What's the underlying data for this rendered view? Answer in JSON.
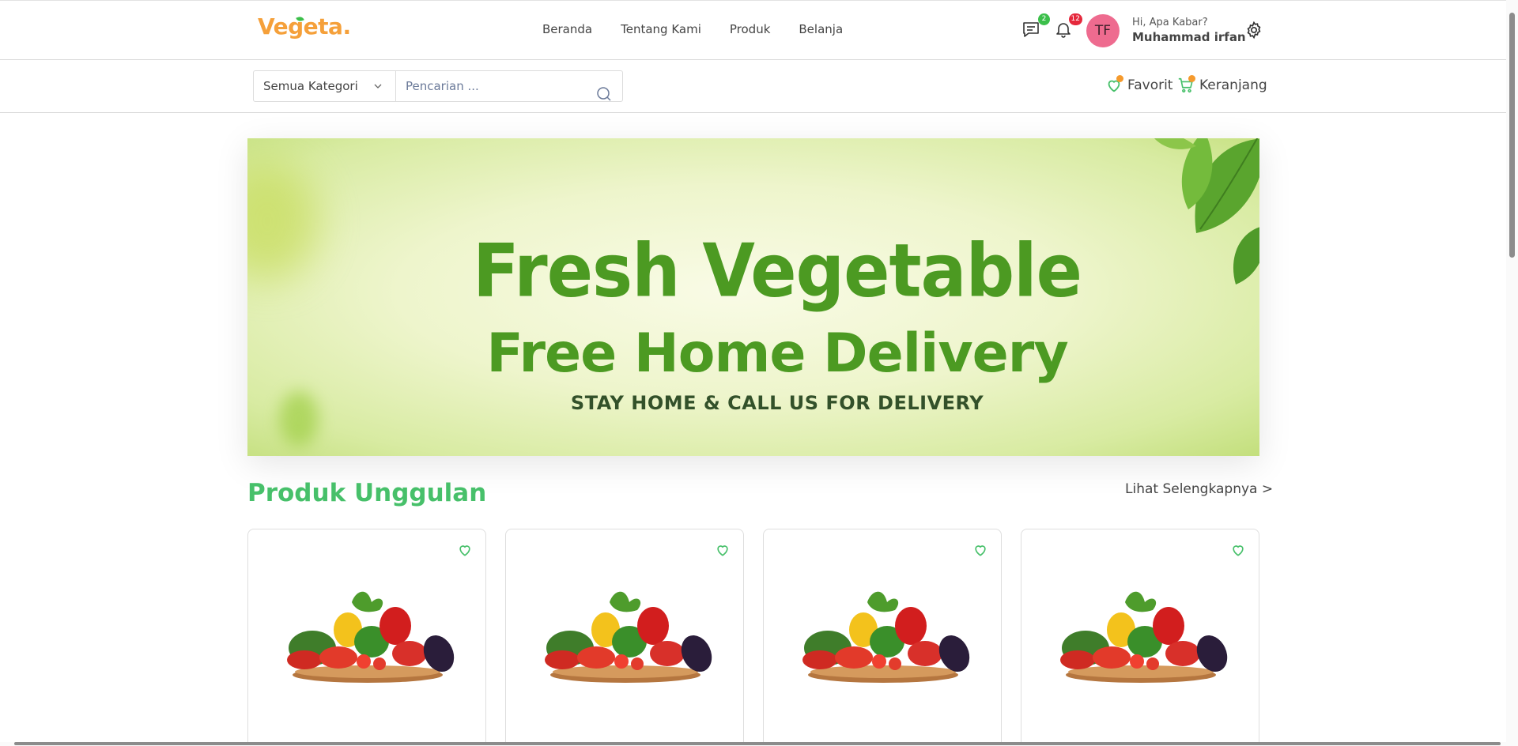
{
  "brand": {
    "logo_text": "Vegeta.",
    "primary_color": "#47c06a",
    "accent_color": "#f5a03a"
  },
  "nav": {
    "items": [
      {
        "label": "Beranda"
      },
      {
        "label": "Tentang Kami"
      },
      {
        "label": "Produk"
      },
      {
        "label": "Belanja"
      }
    ]
  },
  "header": {
    "messages_icon": "chat-icon",
    "messages_count": "2",
    "notifications_icon": "bell-icon",
    "notifications_count": "12",
    "avatar_initials": "TF",
    "greeting": "Hi, Apa Kabar?",
    "user_name": "Muhammad irfan",
    "settings_icon": "gear-icon"
  },
  "search": {
    "category_selected": "Semua Kategori",
    "placeholder": "Pencarian ...",
    "value": ""
  },
  "quick_links": {
    "favorite_label": "Favorit",
    "cart_label": "Keranjang"
  },
  "banner": {
    "headline": "Fresh Vegetable",
    "subheadline": "Free Home Delivery",
    "tagline": "STAY HOME & CALL US FOR DELIVERY"
  },
  "featured": {
    "title": "Produk Unggulan",
    "see_more": "Lihat Selengkapnya >",
    "products": [
      {
        "image": "vegetable-basket"
      },
      {
        "image": "vegetable-basket"
      },
      {
        "image": "vegetable-basket"
      },
      {
        "image": "vegetable-basket"
      }
    ]
  }
}
